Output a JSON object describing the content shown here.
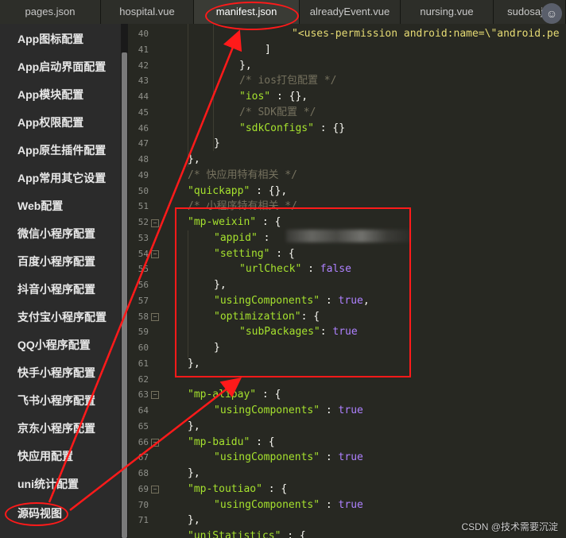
{
  "tabs": [
    {
      "label": "pages.json"
    },
    {
      "label": "hospital.vue"
    },
    {
      "label": "manifest.json"
    },
    {
      "label": "alreadyEvent.vue"
    },
    {
      "label": "nursing.vue"
    },
    {
      "label": "sudosaj..."
    }
  ],
  "active_tab": "manifest.json",
  "sidebar": {
    "items": [
      {
        "label": "App图标配置"
      },
      {
        "label": "App启动界面配置"
      },
      {
        "label": "App模块配置"
      },
      {
        "label": "App权限配置"
      },
      {
        "label": "App原生插件配置"
      },
      {
        "label": "App常用其它设置"
      },
      {
        "label": "Web配置"
      },
      {
        "label": "微信小程序配置"
      },
      {
        "label": "百度小程序配置"
      },
      {
        "label": "抖音小程序配置"
      },
      {
        "label": "支付宝小程序配置"
      },
      {
        "label": "QQ小程序配置"
      },
      {
        "label": "快手小程序配置"
      },
      {
        "label": "飞书小程序配置"
      },
      {
        "label": "京东小程序配置"
      },
      {
        "label": "快应用配置"
      },
      {
        "label": "uni统计配置"
      },
      {
        "label": "源码视图"
      }
    ]
  },
  "editor": {
    "line_numbers": [
      "40",
      "41",
      "42",
      "43",
      "44",
      "45",
      "46",
      "47",
      "48",
      "49",
      "50",
      "51",
      "52",
      "53",
      "54",
      "55",
      "56",
      "57",
      "58",
      "59",
      "60",
      "61",
      "62",
      "63",
      "64",
      "65",
      "66",
      "67",
      "68",
      "69",
      "70",
      "71"
    ],
    "lines": {
      "l40": "\"<uses-permission android:name=\\\"android.pe",
      "l41": "]",
      "l42": "},",
      "l43": "/* ios打包配置 */",
      "l44_key": "\"ios\"",
      "l44_rest": " : {},",
      "l45": "/* SDK配置 */",
      "l46_key": "\"sdkConfigs\"",
      "l46_rest": " : {}",
      "l47": "}",
      "l48": "},",
      "l49": "/* 快应用特有相关 */",
      "l50_key": "\"quickapp\"",
      "l50_rest": " : {},",
      "l51": "/* 小程序特有相关 */",
      "l52_key": "\"mp-weixin\"",
      "l52_rest": " : {",
      "l53_key": "\"appid\"",
      "l53_rest": " : ",
      "l54_key": "\"setting\"",
      "l54_rest": " : {",
      "l55_key": "\"urlCheck\"",
      "l55_mid": " : ",
      "l55_val": "false",
      "l56": "},",
      "l57_key": "\"usingComponents\"",
      "l57_mid": " : ",
      "l57_val": "true",
      "l57_end": ",",
      "l58_key": "\"optimization\"",
      "l58_rest": ": {",
      "l59_key": "\"subPackages\"",
      "l59_mid": ": ",
      "l59_val": "true",
      "l60": "}",
      "l61": "},",
      "l63_key": "\"mp-alipay\"",
      "l63_rest": " : {",
      "l64_key": "\"usingComponents\"",
      "l64_mid": " : ",
      "l64_val": "true",
      "l65": "},",
      "l66_key": "\"mp-baidu\"",
      "l66_rest": " : {",
      "l67_key": "\"usingComponents\"",
      "l67_mid": " : ",
      "l67_val": "true",
      "l68": "},",
      "l69_key": "\"mp-toutiao\"",
      "l69_rest": " : {",
      "l70_key": "\"usingComponents\"",
      "l70_mid": " : ",
      "l70_val": "true",
      "l71": "},",
      "l72_key": "\"uniStatistics\"",
      "l72_rest": " : {"
    }
  },
  "watermark": "CSDN @技术需要沉淀",
  "colors": {
    "annotation_red": "#ff1a1a",
    "editor_bg": "#272822",
    "sidebar_bg": "#2b2b2b"
  }
}
